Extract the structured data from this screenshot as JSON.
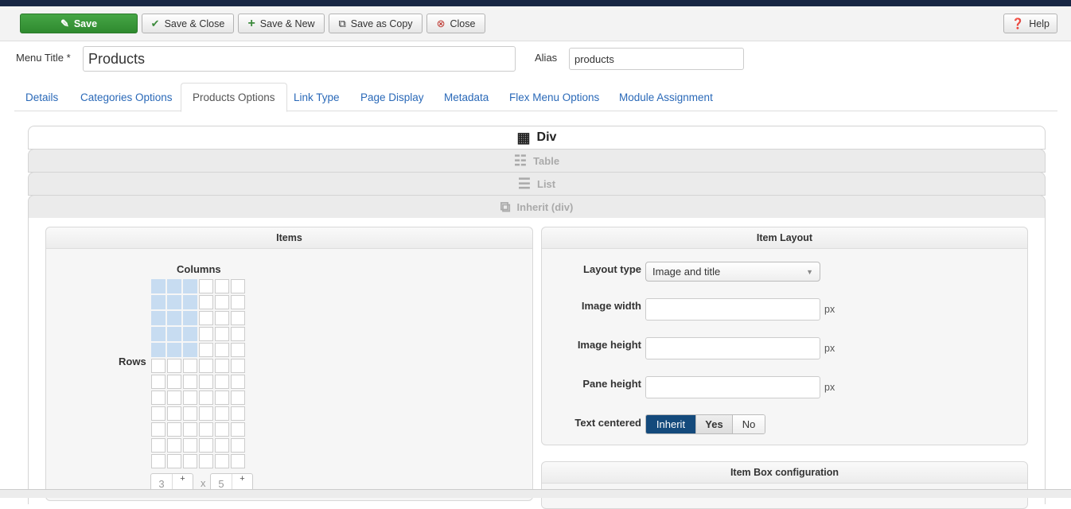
{
  "toolbar": {
    "save": "Save",
    "save_close": "Save & Close",
    "save_new": "Save & New",
    "save_copy": "Save as Copy",
    "close": "Close",
    "help": "Help"
  },
  "form": {
    "menu_title_label": "Menu Title *",
    "menu_title_value": "Products",
    "alias_label": "Alias",
    "alias_value": "products"
  },
  "tabs": [
    "Details",
    "Categories Options",
    "Products Options",
    "Link Type",
    "Page Display",
    "Metadata",
    "Flex Menu Options",
    "Module Assignment"
  ],
  "accordion": {
    "div": "Div",
    "table": "Table",
    "list": "List",
    "inherit": "Inherit (div)"
  },
  "items_panel": {
    "title": "Items",
    "columns_label": "Columns",
    "rows_label": "Rows",
    "grid": {
      "columns": 6,
      "rows": 12,
      "selected_columns": 3,
      "selected_rows": 5
    },
    "columns_value": "3",
    "rows_value": "5",
    "x_sep": "x",
    "plus": "+",
    "minus": "−"
  },
  "item_layout": {
    "title": "Item Layout",
    "layout_type_label": "Layout type",
    "layout_type_value": "Image and title",
    "image_width_label": "Image width",
    "image_height_label": "Image height",
    "pane_height_label": "Pane height",
    "unit": "px",
    "text_centered_label": "Text centered",
    "options": [
      "Inherit",
      "Yes",
      "No"
    ],
    "selected": "Inherit"
  },
  "item_box": {
    "title": "Item Box configuration"
  },
  "colors": {
    "primary": "#144a7c",
    "success": "#3c9a3c"
  }
}
